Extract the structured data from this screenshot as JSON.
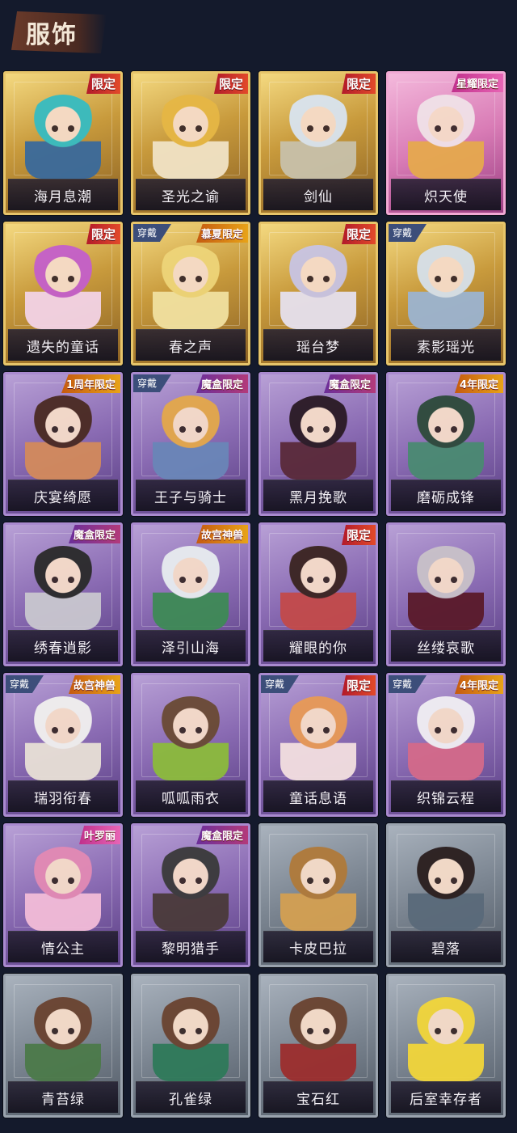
{
  "header": {
    "title": "服饰"
  },
  "items": [
    {
      "name": "海月息潮",
      "frame": "gold",
      "badge": "限定",
      "badge_type": "limited",
      "worn": false,
      "hair": "#36bcc2",
      "cloth": "#3a6a9c"
    },
    {
      "name": "圣光之谕",
      "frame": "gold",
      "badge": "限定",
      "badge_type": "limited",
      "worn": false,
      "hair": "#e6b745",
      "cloth": "#f1e3c6"
    },
    {
      "name": "剑仙",
      "frame": "gold",
      "badge": "限定",
      "badge_type": "limited",
      "worn": false,
      "hair": "#d9e4f0",
      "cloth": "#c8c1aa"
    },
    {
      "name": "炽天使",
      "frame": "pink",
      "badge": "星耀限定",
      "badge_type": "star",
      "worn": false,
      "hair": "#f0e2e8",
      "cloth": "#e6a94e"
    },
    {
      "name": "遗失的童话",
      "frame": "gold",
      "badge": "限定",
      "badge_type": "limited",
      "worn": false,
      "hair": "#c45fcb",
      "cloth": "#f3d3e6"
    },
    {
      "name": "春之声",
      "frame": "gold",
      "badge": "慕夏限定",
      "badge_type": "event",
      "worn": true,
      "wear_label": "穿戴",
      "hair": "#eed579",
      "cloth": "#f1e1a0"
    },
    {
      "name": "瑶台梦",
      "frame": "gold",
      "badge": "限定",
      "badge_type": "limited",
      "worn": false,
      "hair": "#c8c4e4",
      "cloth": "#e6e1ee"
    },
    {
      "name": "素影瑶光",
      "frame": "gold",
      "badge": "",
      "badge_type": "",
      "worn": true,
      "wear_label": "穿戴",
      "hair": "#d6e0ea",
      "cloth": "#9cb4d0"
    },
    {
      "name": "庆宴绮愿",
      "frame": "purple",
      "badge": "1周年限定",
      "badge_type": "event",
      "worn": false,
      "hair": "#4a2a22",
      "cloth": "#d38a5c"
    },
    {
      "name": "王子与骑士",
      "frame": "purple",
      "badge": "魔盒限定",
      "badge_type": "magic",
      "worn": true,
      "wear_label": "穿戴",
      "hair": "#e4a84a",
      "cloth": "#6a86b8"
    },
    {
      "name": "黑月挽歌",
      "frame": "purple",
      "badge": "魔盒限定",
      "badge_type": "magic",
      "worn": false,
      "hair": "#2a1a24",
      "cloth": "#5a2a3a"
    },
    {
      "name": "磨砺成锋",
      "frame": "purple",
      "badge": "4年限定",
      "badge_type": "event",
      "worn": false,
      "hair": "#2d4a3a",
      "cloth": "#4a8a72"
    },
    {
      "name": "绣春逍影",
      "frame": "purple",
      "badge": "魔盒限定",
      "badge_type": "magic",
      "worn": false,
      "hair": "#2a2a2a",
      "cloth": "#c9c7cf"
    },
    {
      "name": "泽引山海",
      "frame": "purple",
      "badge": "故宫神兽",
      "badge_type": "event",
      "worn": false,
      "hair": "#e8edf0",
      "cloth": "#3e8a56"
    },
    {
      "name": "耀眼的你",
      "frame": "purple",
      "badge": "限定",
      "badge_type": "limited",
      "worn": false,
      "hair": "#3a2420",
      "cloth": "#c34a4a"
    },
    {
      "name": "丝缕哀歌",
      "frame": "purple",
      "badge": "",
      "badge_type": "",
      "worn": false,
      "hair": "#c9c2c9",
      "cloth": "#5a1a2a"
    },
    {
      "name": "瑞羽衔春",
      "frame": "purple",
      "badge": "故宫神兽",
      "badge_type": "event",
      "worn": true,
      "wear_label": "穿戴",
      "hair": "#f2f1ef",
      "cloth": "#e8e0d6"
    },
    {
      "name": "呱呱雨衣",
      "frame": "purple",
      "badge": "",
      "badge_type": "",
      "worn": false,
      "hair": "#6a4a34",
      "cloth": "#8cbb3c"
    },
    {
      "name": "童话息语",
      "frame": "purple",
      "badge": "限定",
      "badge_type": "limited",
      "worn": true,
      "wear_label": "穿戴",
      "hair": "#e89a56",
      "cloth": "#f3dfe0"
    },
    {
      "name": "织锦云程",
      "frame": "purple",
      "badge": "4年限定",
      "badge_type": "event",
      "worn": true,
      "wear_label": "穿戴",
      "hair": "#f1eff3",
      "cloth": "#d46a8a"
    },
    {
      "name": "情公主",
      "frame": "purple",
      "badge": "叶罗丽",
      "badge_type": "star",
      "worn": false,
      "hair": "#e38ab4",
      "cloth": "#f3bcd8"
    },
    {
      "name": "黎明猎手",
      "frame": "purple",
      "badge": "魔盒限定",
      "badge_type": "magic",
      "worn": false,
      "hair": "#3a3a3a",
      "cloth": "#4a3a3a"
    },
    {
      "name": "卡皮巴拉",
      "frame": "gray",
      "badge": "",
      "badge_type": "",
      "worn": false,
      "hair": "#b07a3a",
      "cloth": "#d4a052"
    },
    {
      "name": "碧落",
      "frame": "gray",
      "badge": "",
      "badge_type": "",
      "worn": false,
      "hair": "#2a1e1e",
      "cloth": "#5a6a7a"
    },
    {
      "name": "青苔绿",
      "frame": "gray",
      "badge": "",
      "badge_type": "",
      "worn": false,
      "hair": "#6a4330",
      "cloth": "#4c7a4a"
    },
    {
      "name": "孔雀绿",
      "frame": "gray",
      "badge": "",
      "badge_type": "",
      "worn": false,
      "hair": "#6a4330",
      "cloth": "#2f7a5a"
    },
    {
      "name": "宝石红",
      "frame": "gray",
      "badge": "",
      "badge_type": "",
      "worn": false,
      "hair": "#6a4330",
      "cloth": "#9c2e2e"
    },
    {
      "name": "后室幸存者",
      "frame": "gray",
      "badge": "",
      "badge_type": "",
      "worn": false,
      "hair": "#f2d63a",
      "cloth": "#f2d63a"
    }
  ]
}
